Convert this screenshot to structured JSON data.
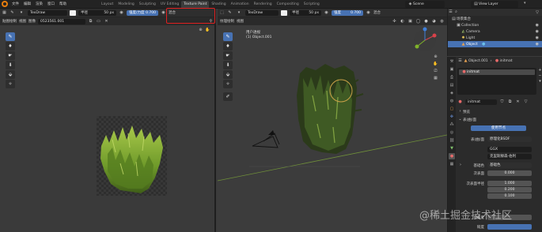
{
  "topbar": {
    "menus": [
      "文件",
      "编辑",
      "渲染",
      "窗口",
      "帮助"
    ],
    "workspaces": [
      "Layout",
      "Modeling",
      "Sculpting",
      "UV Editing",
      "Texture Paint",
      "Shading",
      "Animation",
      "Rendering",
      "Compositing",
      "Scripting"
    ],
    "active_workspace": "Texture Paint",
    "scene": "Scene",
    "view_layer": "View Layer"
  },
  "image_editor": {
    "brush_name": "TexDraw",
    "radius_label": "半径",
    "radius_value": "50 px",
    "strength_label": "强度/力度",
    "strength_value": "0.700",
    "mix_label": "混合",
    "mode": "贴图绘制",
    "view_menu": "视图",
    "image_menu": "图像",
    "image_name": "0523561.001"
  },
  "viewport": {
    "mode": "纹理绘制",
    "view_menu": "视图",
    "brush_name": "TexDraw",
    "radius_label": "半径",
    "radius_value": "50 px",
    "strength_label": "强度",
    "strength_value": "0.700",
    "mix_label": "混合",
    "view_name": "用户透视",
    "object_info": "(1) Object.001"
  },
  "outliner": {
    "header": "场景集合",
    "items": [
      {
        "label": "Collection"
      },
      {
        "label": "Camera"
      },
      {
        "label": "Light"
      },
      {
        "label": "Object"
      }
    ]
  },
  "properties": {
    "object_name": "Object.001",
    "material_name": "initmat",
    "slot_name": "initmat",
    "material_field": "initmat",
    "section_preview": "预览",
    "section_surface": "表(曲)面",
    "use_nodes_button": "使用节点",
    "surface_label": "表(曲)面",
    "surface_value": "原理化BSDF",
    "method_value": "GGX",
    "subsurface_value": "克里斯滕森-伯利",
    "base_color_label": "基础色",
    "base_color_value": "基础色",
    "subsurface_label": "次表面",
    "subsurface_amount": "0.000",
    "subsurface_radius_label": "次表面半径",
    "radius_values": [
      "1.000",
      "0.200",
      "0.100"
    ],
    "metallic_label": "金属度",
    "roughness_label": "糙度"
  },
  "watermark": "@稀土掘金技术社区",
  "colors": {
    "accent": "#4772b3",
    "highlight_box": "#e02020",
    "orange": "#e87d0d"
  }
}
